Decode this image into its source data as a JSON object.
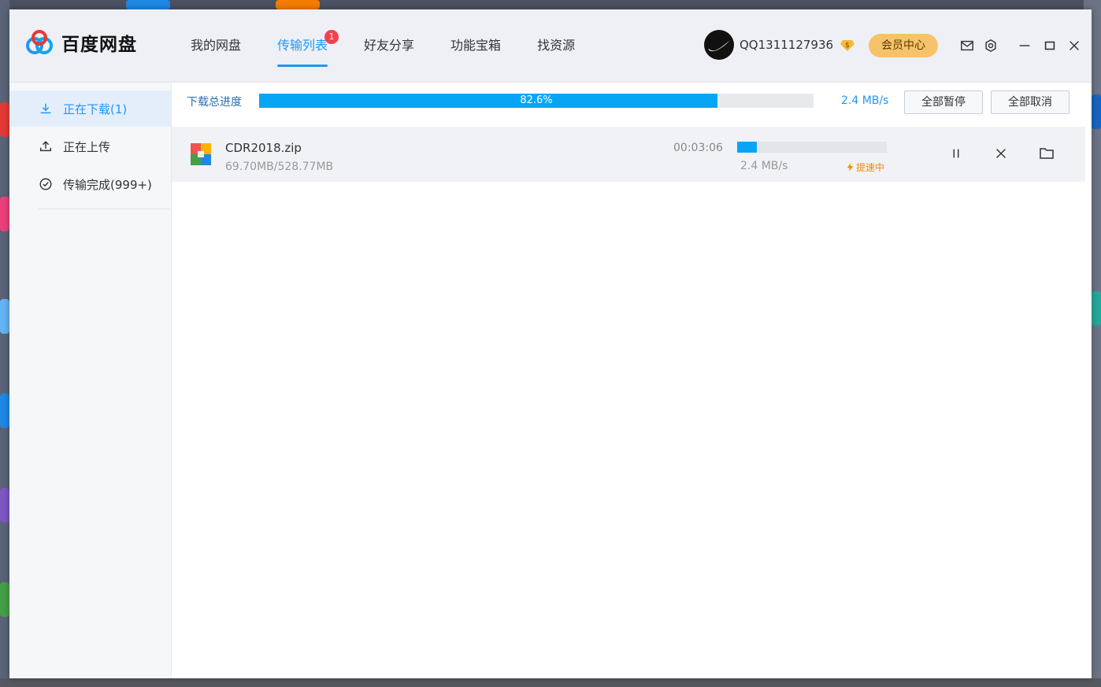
{
  "app": {
    "name": "百度网盘"
  },
  "nav": {
    "items": [
      {
        "label": "我的网盘"
      },
      {
        "label": "传输列表",
        "badge": "1"
      },
      {
        "label": "好友分享"
      },
      {
        "label": "功能宝箱"
      },
      {
        "label": "找资源"
      }
    ]
  },
  "user": {
    "name": "QQ1311127936",
    "member_center": "会员中心"
  },
  "sidebar": {
    "items": [
      {
        "label": "正在下载(1)"
      },
      {
        "label": "正在上传"
      },
      {
        "label": "传输完成(999+)"
      }
    ]
  },
  "overall": {
    "label": "下载总进度",
    "percent_text": "82.6%",
    "percent": 82.6,
    "speed": "2.4 MB/s",
    "pause_all": "全部暂停",
    "cancel_all": "全部取消"
  },
  "download": {
    "file_name": "CDR2018.zip",
    "size": "69.70MB/528.77MB",
    "remaining": "00:03:06",
    "speed": "2.4 MB/s",
    "boost": "提速中",
    "progress": 0.1318
  },
  "colors": {
    "accent": "#2196f3",
    "progress": "#07a6f5",
    "badge": "#f5414c",
    "member": "#f7c36a",
    "boost": "#f08a00"
  }
}
